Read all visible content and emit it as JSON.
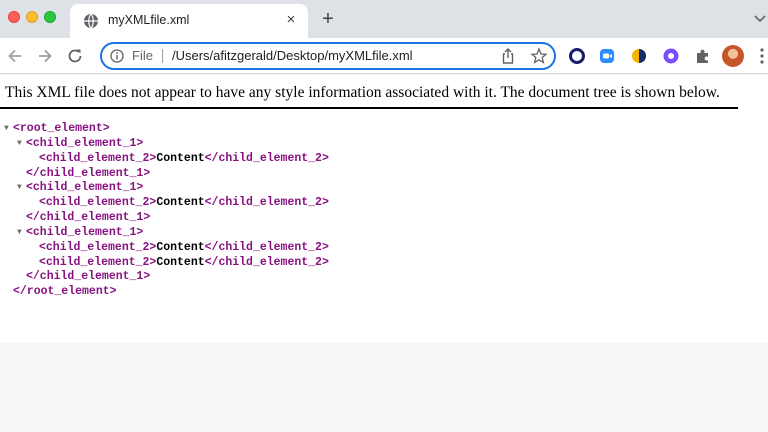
{
  "window": {
    "tab_title": "myXMLfile.xml",
    "tab_close_glyph": "×",
    "new_tab_glyph": "+"
  },
  "address_bar": {
    "scheme_label": "File",
    "url": "/Users/afitzgerald/Desktop/myXMLfile.xml"
  },
  "icons": {
    "back": "arrow-left-icon",
    "forward": "arrow-right-icon",
    "reload": "reload-icon",
    "info": "info-icon",
    "share": "share-icon",
    "bookmark": "star-icon",
    "extensions": [
      "opera-ring-icon",
      "blue-square-icon",
      "yellow-drop-icon",
      "purple-gear-icon",
      "puzzle-icon"
    ],
    "menu": "kebab-menu-icon"
  },
  "colors": {
    "accent": "#1a73e8",
    "tag": "#881280",
    "tab_bar": "#dee1e6"
  },
  "page": {
    "notice": "This XML file does not appear to have any style information associated with it. The document tree is shown below.",
    "tree": [
      {
        "indent": 0,
        "fold": true,
        "open": "<root_element>",
        "content": "",
        "close": ""
      },
      {
        "indent": 1,
        "fold": true,
        "open": "<child_element_1>",
        "content": "",
        "close": ""
      },
      {
        "indent": 2,
        "fold": false,
        "open": "<child_element_2>",
        "content": "Content",
        "close": "</child_element_2>"
      },
      {
        "indent": 1,
        "fold": false,
        "open": "</child_element_1>",
        "content": "",
        "close": ""
      },
      {
        "indent": 1,
        "fold": true,
        "open": "<child_element_1>",
        "content": "",
        "close": ""
      },
      {
        "indent": 2,
        "fold": false,
        "open": "<child_element_2>",
        "content": "Content",
        "close": "</child_element_2>"
      },
      {
        "indent": 1,
        "fold": false,
        "open": "</child_element_1>",
        "content": "",
        "close": ""
      },
      {
        "indent": 1,
        "fold": true,
        "open": "<child_element_1>",
        "content": "",
        "close": ""
      },
      {
        "indent": 2,
        "fold": false,
        "open": "<child_element_2>",
        "content": "Content",
        "close": "</child_element_2>"
      },
      {
        "indent": 2,
        "fold": false,
        "open": "<child_element_2>",
        "content": "Content",
        "close": "</child_element_2>"
      },
      {
        "indent": 1,
        "fold": false,
        "open": "</child_element_1>",
        "content": "",
        "close": ""
      },
      {
        "indent": 0,
        "fold": false,
        "open": "</root_element>",
        "content": "",
        "close": ""
      }
    ]
  }
}
